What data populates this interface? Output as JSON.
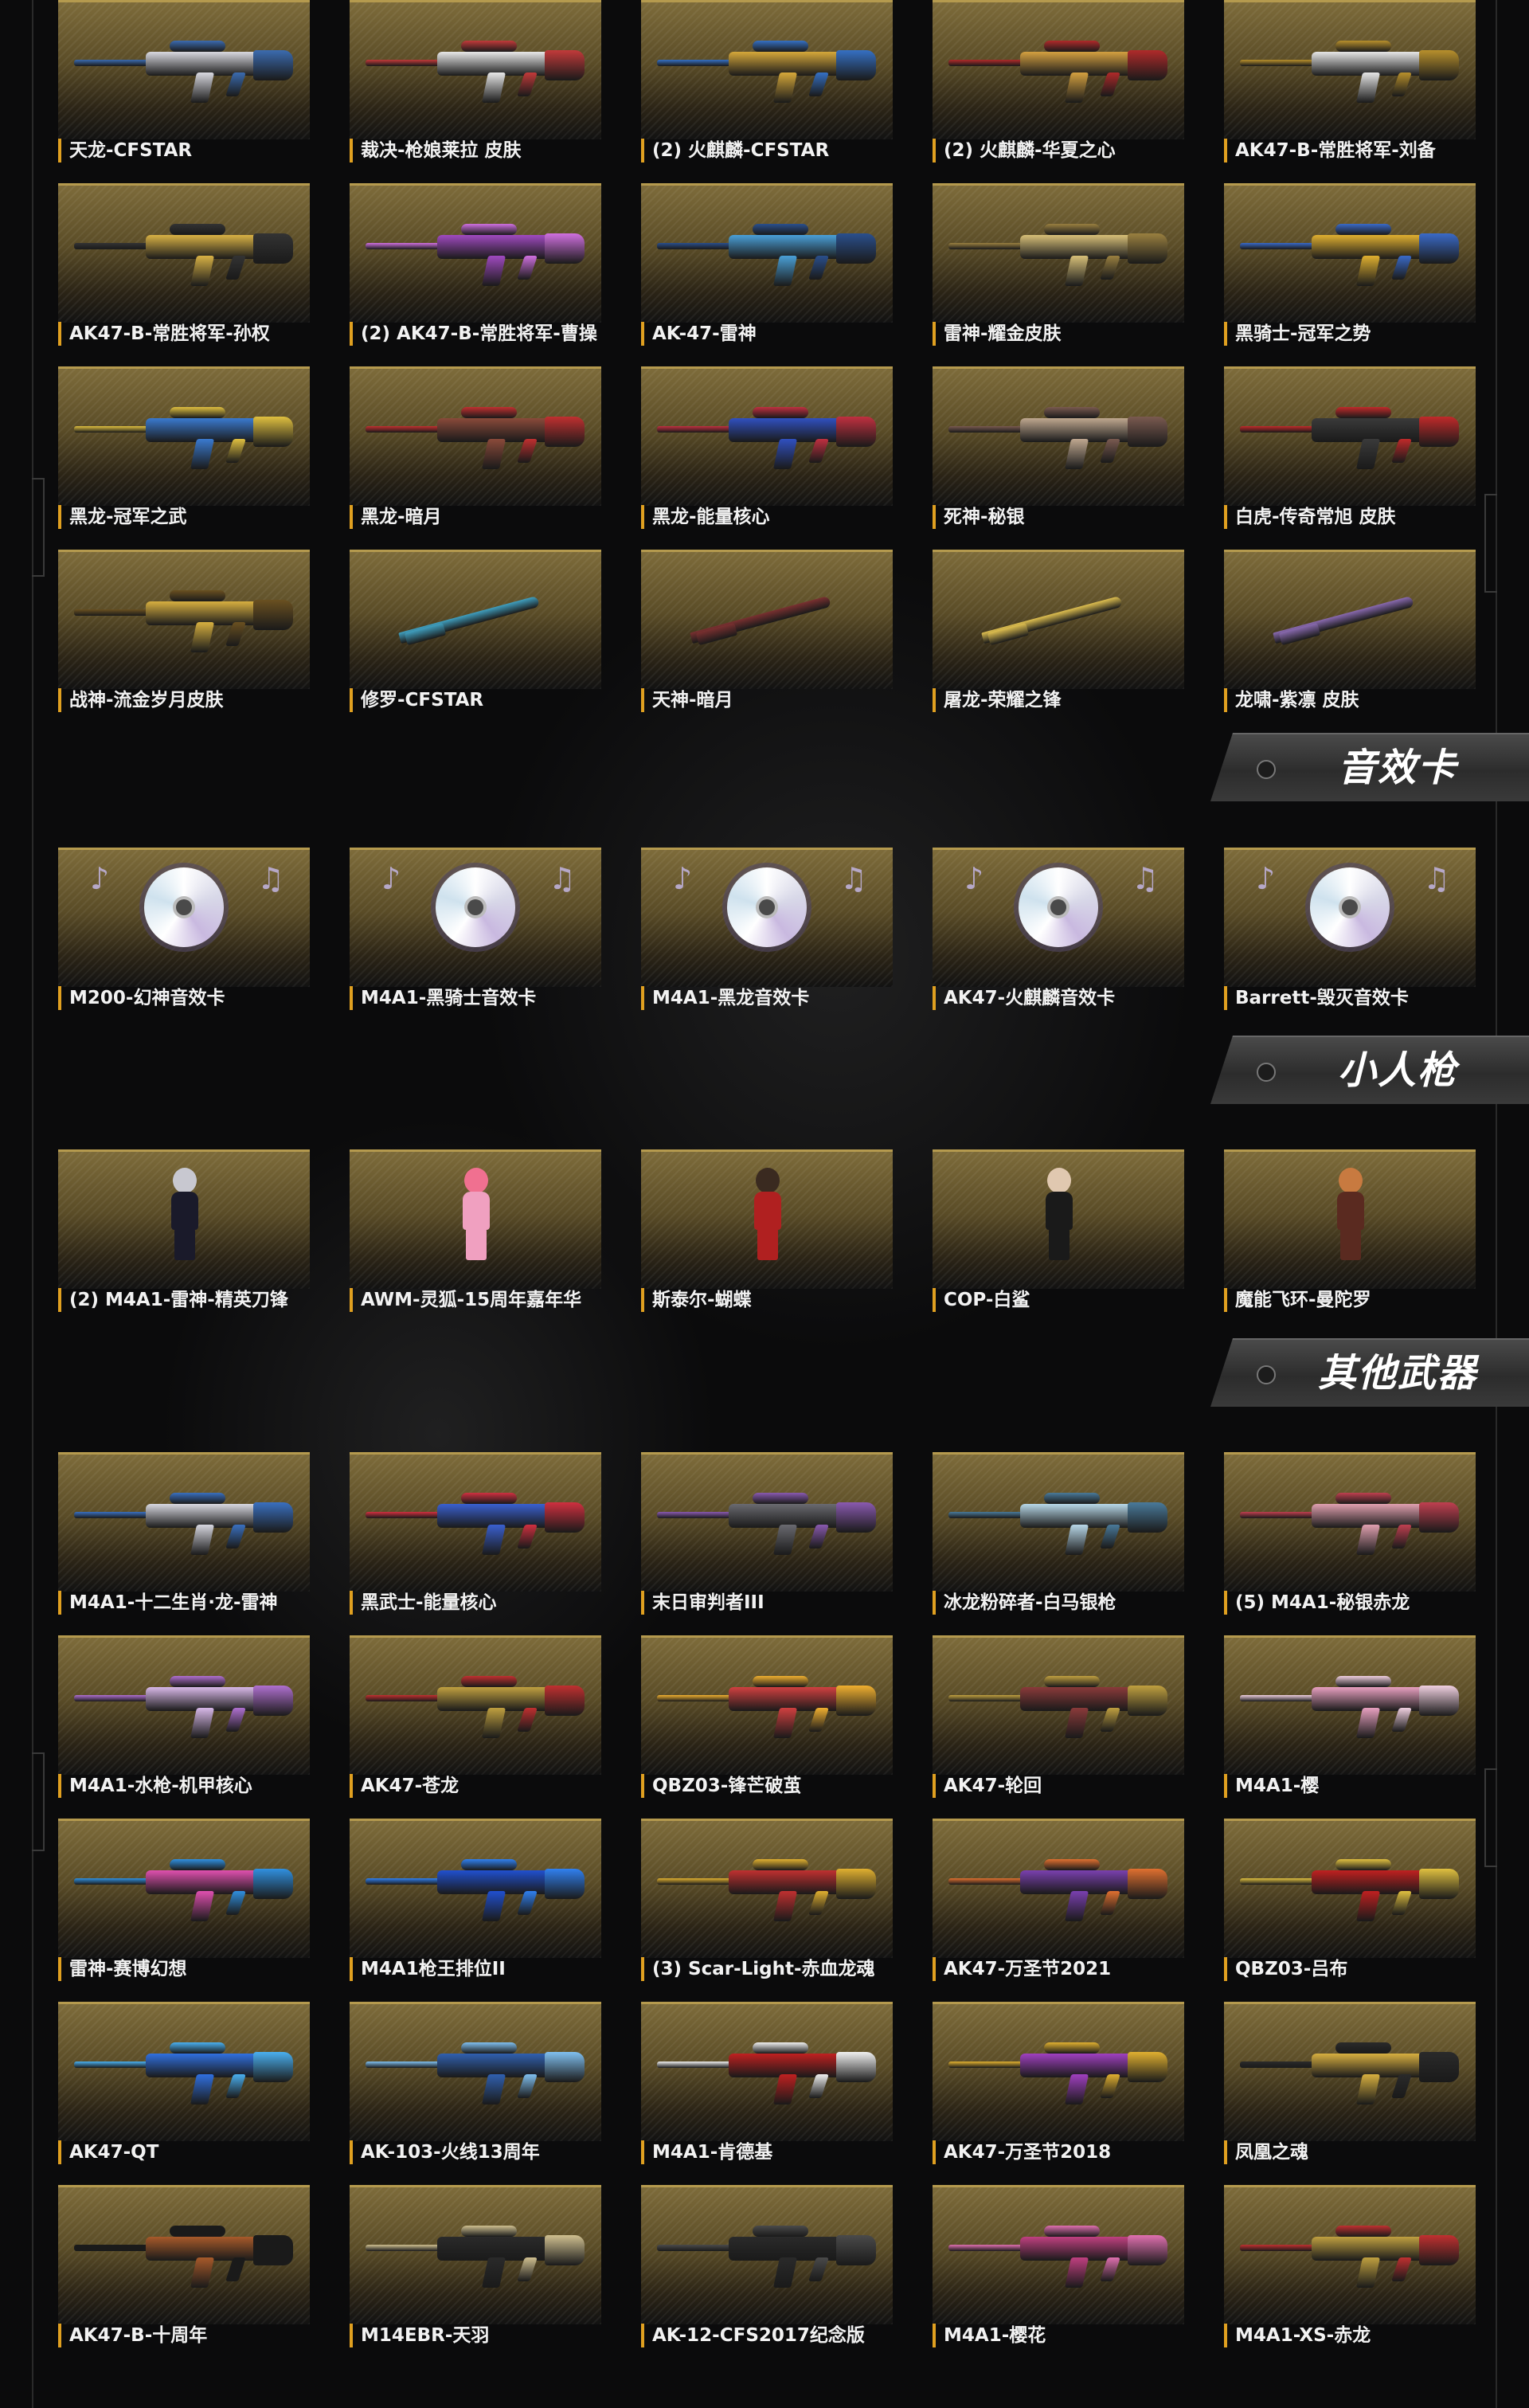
{
  "sections": {
    "s1": {
      "items": [
        {
          "name": "天龙-CFSTAR",
          "kind": "gun",
          "c1": "#d9d9e0",
          "c2": "#3b6bb0"
        },
        {
          "name": "裁决-枪娘莱拉 皮肤",
          "kind": "gun",
          "c1": "#e8e8e8",
          "c2": "#c23a3a"
        },
        {
          "name": "(2) 火麒麟-CFSTAR",
          "kind": "gun",
          "c1": "#d6a83a",
          "c2": "#3570c4"
        },
        {
          "name": "(2) 火麒麟-华夏之心",
          "kind": "gun",
          "c1": "#d4a040",
          "c2": "#b02a2a"
        },
        {
          "name": "AK47-B-常胜将军-刘备",
          "kind": "gun",
          "c1": "#e6e6e6",
          "c2": "#b8902c"
        },
        {
          "name": "AK47-B-常胜将军-孙权",
          "kind": "gun",
          "c1": "#d9b245",
          "c2": "#333333"
        },
        {
          "name": "(2) AK47-B-常胜将军-曹操",
          "kind": "gun",
          "c1": "#a04ac0",
          "c2": "#d070e0"
        },
        {
          "name": "AK-47-雷神",
          "kind": "gun",
          "c1": "#4aa0d8",
          "c2": "#2a4f8c"
        },
        {
          "name": "雷神-耀金皮肤",
          "kind": "gun",
          "c1": "#d8c078",
          "c2": "#9a8040"
        },
        {
          "name": "黑骑士-冠军之势",
          "kind": "gun",
          "c1": "#e0b030",
          "c2": "#3a6ac8"
        },
        {
          "name": "黑龙-冠军之武",
          "kind": "gun",
          "c1": "#3a7ad0",
          "c2": "#e0c040"
        },
        {
          "name": "黑龙-暗月",
          "kind": "gun",
          "c1": "#8a4a3a",
          "c2": "#c03030"
        },
        {
          "name": "黑龙-能量核心",
          "kind": "gun",
          "c1": "#3050c0",
          "c2": "#c03040"
        },
        {
          "name": "死神-秘银",
          "kind": "gun",
          "c1": "#c0a890",
          "c2": "#7a5a50"
        },
        {
          "name": "白虎-传奇常旭 皮肤",
          "kind": "gun",
          "c1": "#3a3a3a",
          "c2": "#c02a2a"
        },
        {
          "name": "战神-流金岁月皮肤",
          "kind": "gun",
          "c1": "#d8b040",
          "c2": "#6a5020"
        },
        {
          "name": "修罗-CFSTAR",
          "kind": "knife",
          "c1": "#e0c040",
          "c2": "#40a0c0"
        },
        {
          "name": "天神-暗月",
          "kind": "knife",
          "c1": "#c0c0c8",
          "c2": "#7a3030"
        },
        {
          "name": "屠龙-荣耀之锋",
          "kind": "knife",
          "c1": "#3a90d8",
          "c2": "#e0c050"
        },
        {
          "name": "龙啸-紫凛 皮肤",
          "kind": "knife",
          "c1": "#b8b8c8",
          "c2": "#8a6ab0"
        }
      ]
    },
    "s2": {
      "title": "音效卡",
      "items": [
        {
          "name": "M200-幻神音效卡"
        },
        {
          "name": "M4A1-黑骑士音效卡"
        },
        {
          "name": "M4A1-黑龙音效卡"
        },
        {
          "name": "AK47-火麒麟音效卡"
        },
        {
          "name": "Barrett-毁灭音效卡"
        }
      ]
    },
    "s3": {
      "title": "小人枪",
      "items": [
        {
          "name": "(2) M4A1-雷神-精英刀锋",
          "c1": "#c8c8d0",
          "c2": "#1a1a2a"
        },
        {
          "name": "AWM-灵狐-15周年嘉年华",
          "c1": "#f07090",
          "c2": "#f0a0c0"
        },
        {
          "name": "斯泰尔-蝴蝶",
          "c1": "#3a2a20",
          "c2": "#b02020"
        },
        {
          "name": "COP-白鲨",
          "c1": "#e0c8b0",
          "c2": "#1a1a1a"
        },
        {
          "name": "魔能飞环-曼陀罗",
          "c1": "#c87a40",
          "c2": "#5a2a20"
        }
      ]
    },
    "s4": {
      "title": "其他武器",
      "items": [
        {
          "name": "M4A1-十二生肖·龙-雷神",
          "kind": "gun",
          "c1": "#d8d8e0",
          "c2": "#3a70c0"
        },
        {
          "name": "黑武士-能量核心",
          "kind": "gun",
          "c1": "#3a60d0",
          "c2": "#d03040"
        },
        {
          "name": "末日审判者III",
          "kind": "gun",
          "c1": "#6a6a70",
          "c2": "#8a5ab0"
        },
        {
          "name": "冰龙粉碎者-白马银枪",
          "kind": "gun",
          "c1": "#b8d8e8",
          "c2": "#4a7a9a"
        },
        {
          "name": "(5) M4A1-秘银赤龙",
          "kind": "gun",
          "c1": "#e0a0b0",
          "c2": "#c04050"
        },
        {
          "name": "M4A1-水枪-机甲核心",
          "kind": "gun",
          "c1": "#d8b8e8",
          "c2": "#b070d0"
        },
        {
          "name": "AK47-苍龙",
          "kind": "gun",
          "c1": "#c0a040",
          "c2": "#c03030"
        },
        {
          "name": "QBZ03-锋芒破茧",
          "kind": "gun",
          "c1": "#d04040",
          "c2": "#f0b030"
        },
        {
          "name": "AK47-轮回",
          "kind": "gun",
          "c1": "#8a3a3a",
          "c2": "#c0a040"
        },
        {
          "name": "M4A1-樱",
          "kind": "gun",
          "c1": "#e8a0c0",
          "c2": "#f0d0e0"
        },
        {
          "name": "雷神-赛博幻想",
          "kind": "gun",
          "c1": "#e050b0",
          "c2": "#3090e0"
        },
        {
          "name": "M4A1枪王排位II",
          "kind": "gun",
          "c1": "#2050d0",
          "c2": "#3080f0"
        },
        {
          "name": "(3) Scar-Light-赤血龙魂",
          "kind": "gun",
          "c1": "#c03030",
          "c2": "#e0b030"
        },
        {
          "name": "AK47-万圣节2021",
          "kind": "gun",
          "c1": "#7a40b0",
          "c2": "#e07030"
        },
        {
          "name": "QBZ03-吕布",
          "kind": "gun",
          "c1": "#c02020",
          "c2": "#e0c040"
        },
        {
          "name": "AK47-QT",
          "kind": "gun",
          "c1": "#3070e0",
          "c2": "#4ab0f0"
        },
        {
          "name": "AK-103-火线13周年",
          "kind": "gun",
          "c1": "#3060b0",
          "c2": "#80c0f0"
        },
        {
          "name": "M4A1-肯德基",
          "kind": "gun",
          "c1": "#c02020",
          "c2": "#f0f0f0"
        },
        {
          "name": "AK47-万圣节2018",
          "kind": "gun",
          "c1": "#a040c0",
          "c2": "#e0b030"
        },
        {
          "name": "凤凰之魂",
          "kind": "gun",
          "c1": "#d8b040",
          "c2": "#2a2a2a"
        },
        {
          "name": "AK47-B-十周年",
          "kind": "gun",
          "c1": "#a85a2a",
          "c2": "#1a1a1a"
        },
        {
          "name": "M14EBR-天羽",
          "kind": "gun",
          "c1": "#2a2a2a",
          "c2": "#d0c090"
        },
        {
          "name": "AK-12-CFS2017纪念版",
          "kind": "gun",
          "c1": "#2a2a2a",
          "c2": "#4a4a4a"
        },
        {
          "name": "M4A1-樱花",
          "kind": "gun",
          "c1": "#c04080",
          "c2": "#e070b0"
        },
        {
          "name": "M4A1-XS-赤龙",
          "kind": "gun",
          "c1": "#c0a040",
          "c2": "#c03030"
        }
      ]
    }
  }
}
